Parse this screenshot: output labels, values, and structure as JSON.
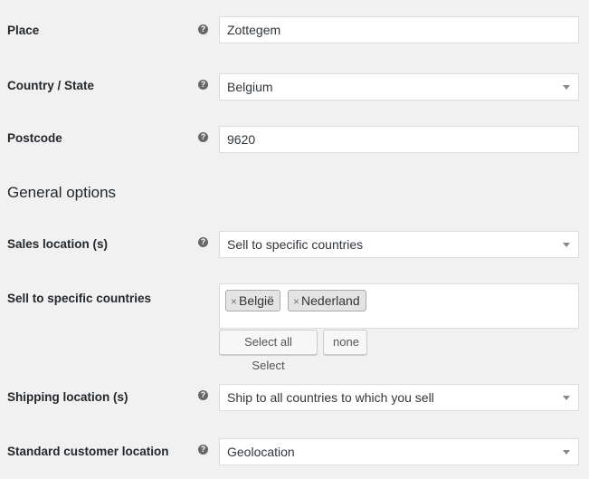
{
  "address": {
    "place_label": "Place",
    "place_value": "Zottegem",
    "country_label": "Country / State",
    "country_value": "Belgium",
    "postcode_label": "Postcode",
    "postcode_value": "9620"
  },
  "general": {
    "section_title": "General options",
    "sales_location_label": "Sales location (s)",
    "sales_location_value": "Sell to specific countries",
    "specific_countries_label": "Sell to specific countries",
    "specific_countries_tags": [
      "België",
      "Nederland"
    ],
    "select_all_label": "Select all Select",
    "select_none_label": "none",
    "shipping_location_label": "Shipping location (s)",
    "shipping_location_value": "Ship to all countries to which you sell",
    "customer_location_label": "Standard customer location",
    "customer_location_value": "Geolocation"
  },
  "help_icon_glyph": "?",
  "remove_glyph": "×"
}
